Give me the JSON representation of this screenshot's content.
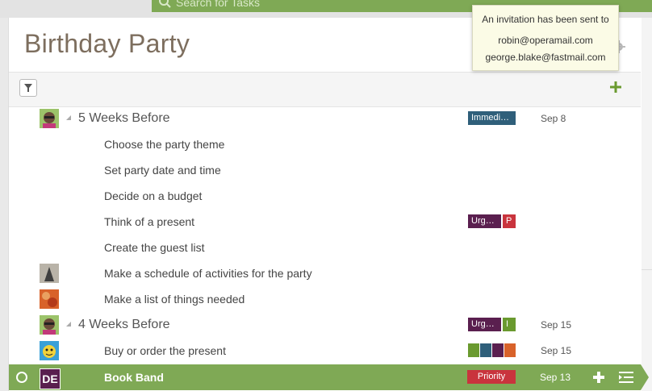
{
  "search": {
    "placeholder": "Search for Tasks"
  },
  "page": {
    "title": "Birthday Party"
  },
  "tooltip": {
    "message": "An invitation has been sent to",
    "emails": [
      "robin@operamail.com",
      "george.blake@fastmail.com"
    ]
  },
  "rows": [
    {
      "kind": "group",
      "text": "5 Weeks Before",
      "tag": "Immedi…",
      "date": "Sep 8"
    },
    {
      "kind": "task",
      "text": "Choose the party theme"
    },
    {
      "kind": "task",
      "text": "Set party date and time"
    },
    {
      "kind": "task",
      "text": "Decide on a budget"
    },
    {
      "kind": "task",
      "text": "Think of a present",
      "tag": "Urg…",
      "tag2": "P"
    },
    {
      "kind": "task",
      "text": "Create the guest list"
    },
    {
      "kind": "task",
      "text": "Make a schedule of activities for the party"
    },
    {
      "kind": "task",
      "text": "Make a list of things needed"
    },
    {
      "kind": "group",
      "text": "4 Weeks Before",
      "tag": "Urg…",
      "tag2": "I",
      "date": "Sep 15"
    },
    {
      "kind": "task",
      "text": "Buy or order the present",
      "date": "Sep 15"
    }
  ],
  "active_task": {
    "avatar_initials": "DE",
    "text": "Book Band",
    "priority": "Priority",
    "date": "Sep 13"
  },
  "colors": {
    "green": "#7fa955",
    "immediate_tag": "#2f5f7a",
    "urgent_tag": "#5a1f4f",
    "priority_red": "#c9343d",
    "tag_green": "#6a9a2f",
    "tag_orange": "#d8622a",
    "tag_blue": "#2f5f7a"
  },
  "icons": [
    "search-icon",
    "gear-icon",
    "filter-icon",
    "add-icon",
    "caret-icon",
    "circle-icon",
    "plus-icon",
    "indent-icon"
  ]
}
